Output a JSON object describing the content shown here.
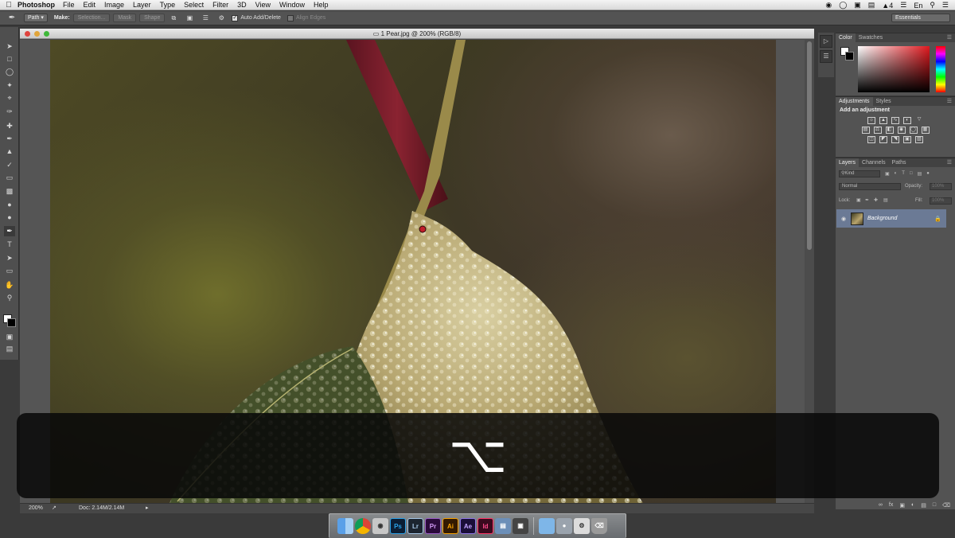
{
  "menubar": {
    "apple": "",
    "app_name": "Photoshop",
    "items": [
      "File",
      "Edit",
      "Image",
      "Layer",
      "Type",
      "Select",
      "Filter",
      "3D",
      "View",
      "Window",
      "Help"
    ],
    "battery": "4",
    "input_source": "En"
  },
  "options_bar": {
    "mode": "Path",
    "make_label": "Make:",
    "selection_btn": "Selection...",
    "mask_btn": "Mask",
    "shape_btn": "Shape",
    "auto_add_delete": "Auto Add/Delete",
    "align_edges": "Align Edges",
    "workspace": "Essentials"
  },
  "document": {
    "title": "1 Pear.jpg @ 200% (RGB/8)",
    "zoom": "200%",
    "doc_size": "Doc: 2.14M/2.14M"
  },
  "panels": {
    "color_tabs": [
      "Color",
      "Swatches"
    ],
    "adjust_tabs": [
      "Adjustments",
      "Styles"
    ],
    "add_adjustment": "Add an adjustment",
    "layers_tabs": [
      "Layers",
      "Channels",
      "Paths"
    ],
    "kind": "Kind",
    "blend_mode": "Normal",
    "opacity_label": "Opacity:",
    "opacity_value": "100%",
    "lock_label": "Lock:",
    "fill_label": "Fill:",
    "fill_value": "100%",
    "layer_name": "Background"
  },
  "dock": {
    "apps": [
      "Finder",
      "Chrome",
      "Preview",
      "Ps",
      "Lr",
      "Pr",
      "Ai",
      "Ae",
      "Id",
      "Screen",
      "Photos",
      "Folder",
      "Apps",
      "Prefs",
      "Trash"
    ]
  },
  "overlay": {
    "key_symbol": "⌥"
  },
  "colors": {
    "layer_highlight": "#6b7a95",
    "photoshop_blue": "#2aa1e8",
    "accent_red": "#d62b2b"
  }
}
